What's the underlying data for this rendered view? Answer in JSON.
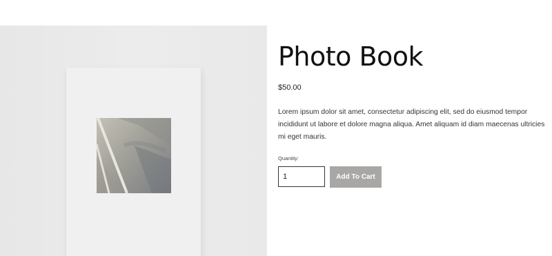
{
  "product": {
    "title": "Photo Book",
    "price": "$50.00",
    "description": "Lorem ipsum dolor sit amet, consectetur adipiscing elit, sed do eiusmod tempor incididunt ut labore et dolore magna aliqua. Amet aliquam id diam maecenas ultricies mi eget mauris.",
    "quantity_label": "Quantity:",
    "quantity_value": "1",
    "add_to_cart_label": "Add To Cart"
  },
  "colors": {
    "button_bg": "#a8a7a5",
    "button_text": "#ffffff",
    "image_panel_bg": "#e9e9e9"
  }
}
